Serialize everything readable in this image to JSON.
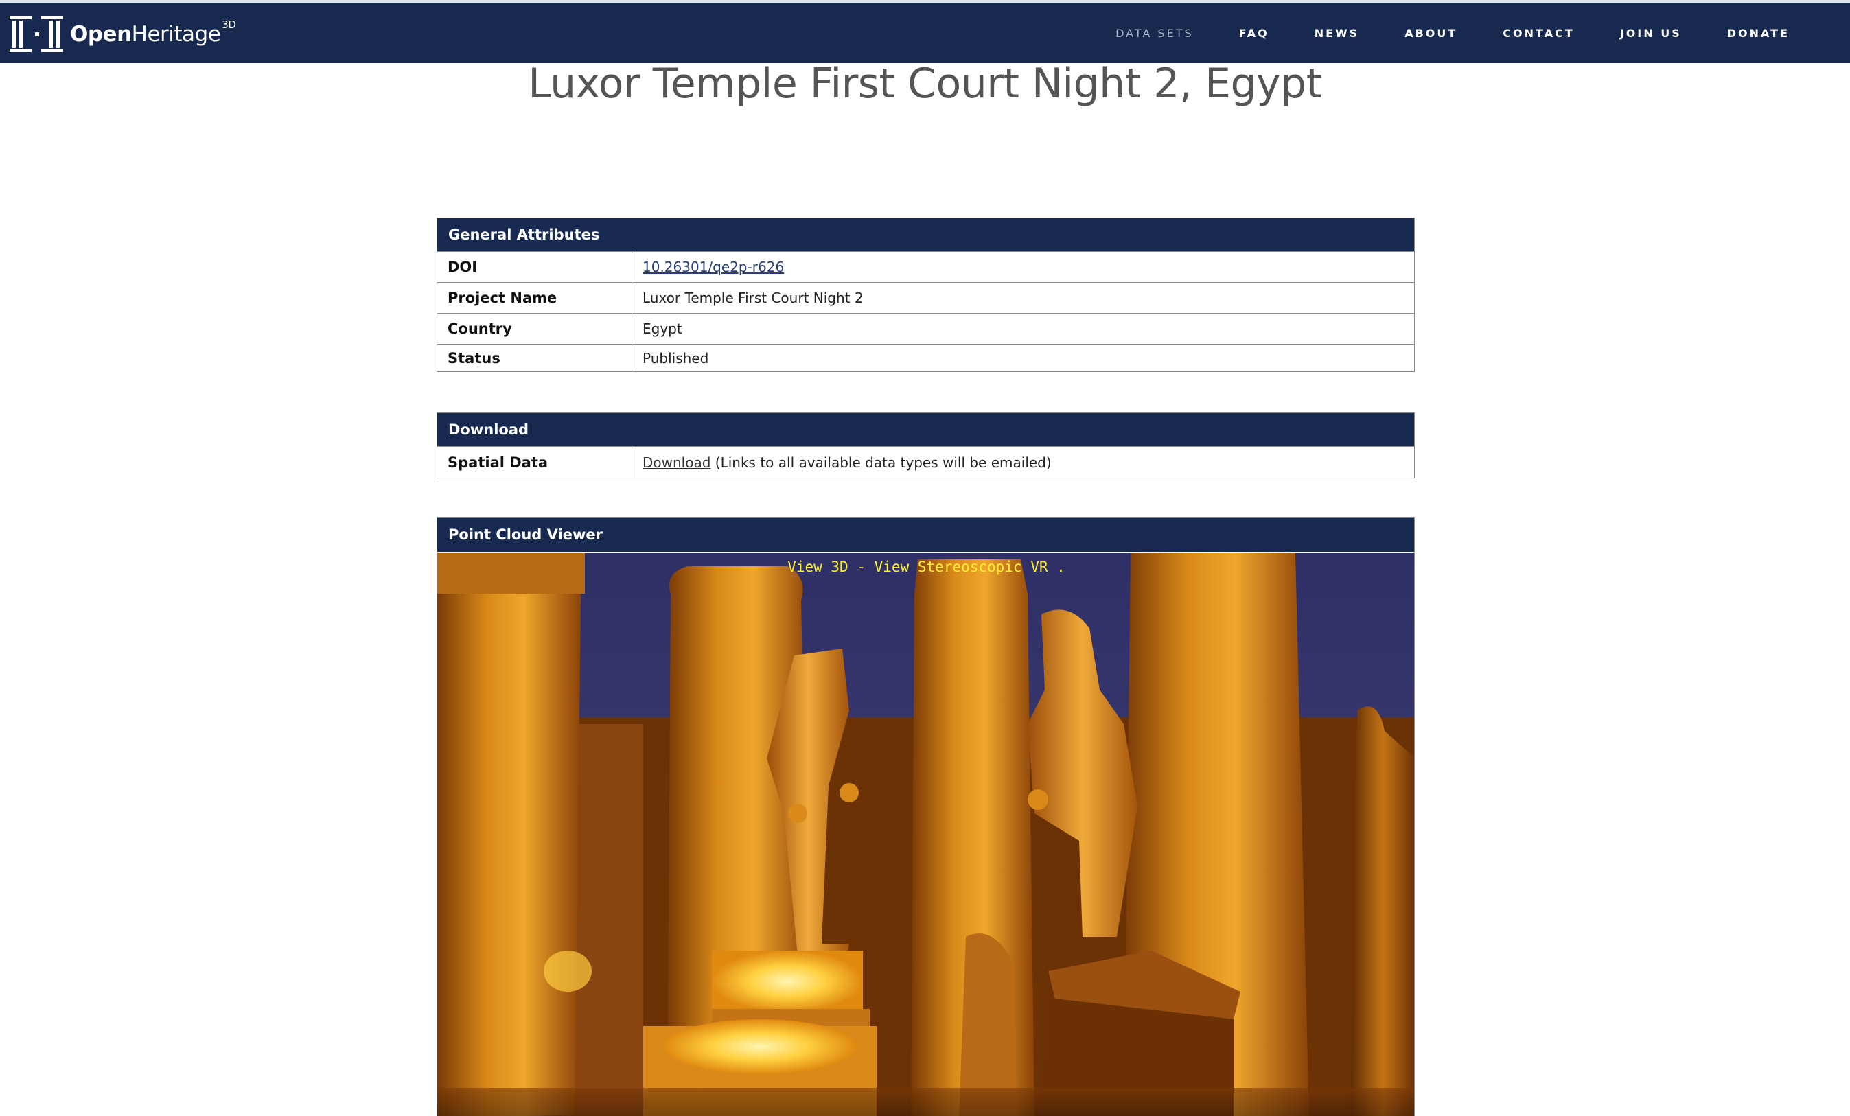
{
  "site": {
    "logo_text_bold": "Open",
    "logo_text_light": "Heritage",
    "logo_sup": "3D"
  },
  "nav": {
    "items": [
      {
        "label": "DATA SETS",
        "active": true
      },
      {
        "label": "FAQ",
        "active": false
      },
      {
        "label": "NEWS",
        "active": false
      },
      {
        "label": "ABOUT",
        "active": false
      },
      {
        "label": "CONTACT",
        "active": false
      },
      {
        "label": "JOIN US",
        "active": false
      },
      {
        "label": "DONATE",
        "active": false
      }
    ]
  },
  "page": {
    "title": "Luxor Temple First Court Night 2, Egypt"
  },
  "general_attributes": {
    "heading": "General Attributes",
    "rows": [
      {
        "label": "DOI",
        "value": "10.26301/qe2p-r626"
      },
      {
        "label": "Project Name",
        "value": "Luxor Temple First Court Night 2"
      },
      {
        "label": "Country",
        "value": "Egypt"
      },
      {
        "label": "Status",
        "value": "Published"
      }
    ]
  },
  "download": {
    "heading": "Download",
    "row_label": "Spatial Data",
    "link_text": "Download",
    "note": " (Links to all available data types will be emailed)"
  },
  "viewer": {
    "heading": "Point Cloud Viewer",
    "link_3d": "View 3D",
    "separator": " - ",
    "link_vr": "View Stereoscopic VR",
    "trailing": " ."
  },
  "colors": {
    "navy": "#17294f",
    "nav_active": "#a9b5c9",
    "link": "#2a3f78",
    "viewer_link": "#ffee33"
  }
}
